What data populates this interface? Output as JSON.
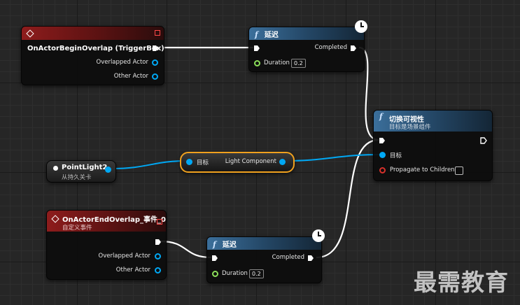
{
  "colors": {
    "event_header": "#8e1c1c",
    "function_header": "#3b6f9b",
    "object_pin": "#00a8f4",
    "float_pin": "#8ce05a",
    "bool_pin": "#d8312b",
    "exec_wire": "#ffffff",
    "selected_outline": "#f0a11e"
  },
  "icons": {
    "event": "diamond-icon",
    "function": "function-f-icon",
    "latent": "clock-icon",
    "light": "light-bulb-icon"
  },
  "begin_overlap": {
    "title": "OnActorBeginOverlap (TriggerBox)",
    "pins": [
      "Overlapped Actor",
      "Other Actor"
    ]
  },
  "delay_top": {
    "title": "延迟",
    "completed": "Completed",
    "duration_label": "Duration",
    "duration_value": "0.2"
  },
  "toggle_visibility": {
    "title": "切换可视性",
    "subtitle": "目标是场景组件",
    "target": "目标",
    "propagate": "Propagate to Children"
  },
  "point_light": {
    "title": "PointLight2",
    "subtitle": "从持久关卡"
  },
  "light_component": {
    "target": "目标",
    "output": "Light Component"
  },
  "end_overlap": {
    "title": "OnActorEndOverlap_事件_0",
    "subtitle": "自定义事件",
    "pins": [
      "Overlapped Actor",
      "Other Actor"
    ]
  },
  "delay_bottom": {
    "title": "延迟",
    "completed": "Completed",
    "duration_label": "Duration",
    "duration_value": "0.2"
  },
  "watermark": "最需教育"
}
